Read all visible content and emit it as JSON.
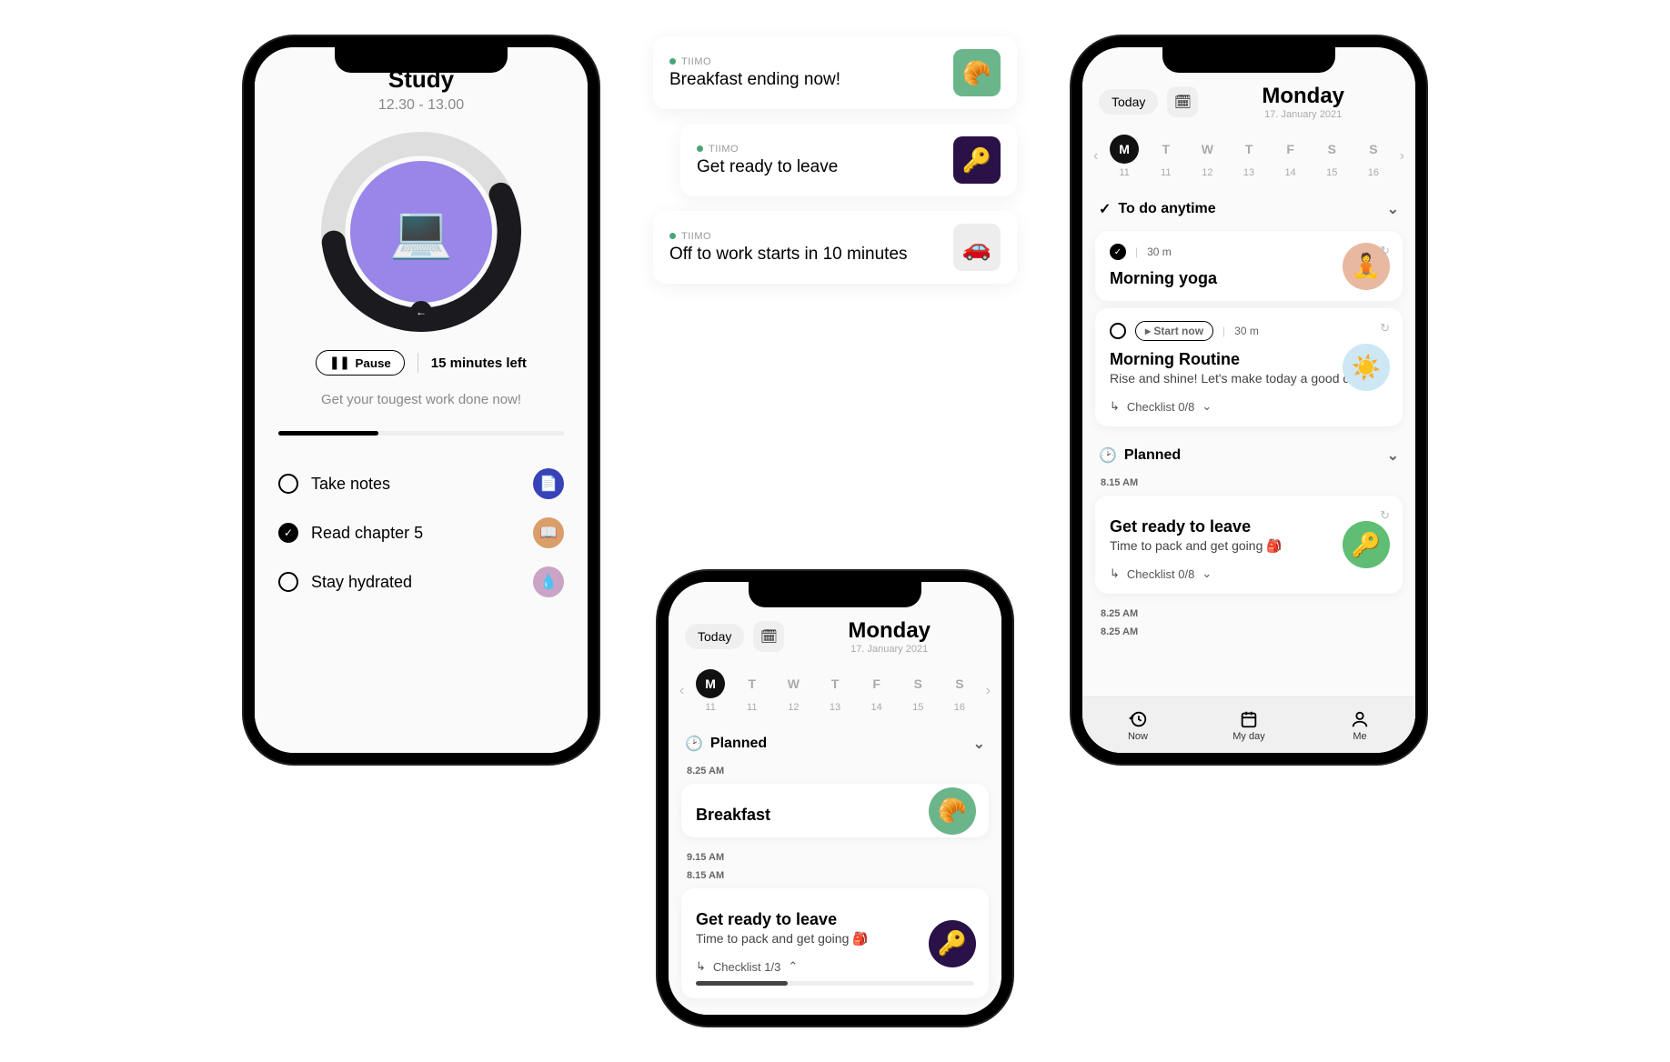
{
  "phone1": {
    "title": "Study",
    "timerange": "12.30 - 13.00",
    "progress_pct": 55,
    "pause_label": "Pause",
    "time_left": "15 minutes left",
    "motivation": "Get your tougest work done now!",
    "overall_progress_pct": 35,
    "checklist": [
      {
        "label": "Take notes",
        "done": false,
        "badge_emoji": "📄",
        "badge_color": "#3943B7"
      },
      {
        "label": "Read chapter 5",
        "done": true,
        "badge_emoji": "📖",
        "badge_color": "#D99E6A"
      },
      {
        "label": "Stay hydrated",
        "done": false,
        "badge_emoji": "💧",
        "badge_color": "#C9A4C7"
      }
    ],
    "activity_emoji": "💻",
    "ring_stroke": "#1b1b1f",
    "ring_track": "#dedede",
    "inner_color": "#9A85E8"
  },
  "notifications": [
    {
      "app": "TIIMO",
      "title": "Breakfast ending now!",
      "emoji": "🥐",
      "bg": "#6BB58B",
      "indent": false
    },
    {
      "app": "TIIMO",
      "title": "Get ready to leave",
      "emoji": "🔑",
      "bg": "#2A1147",
      "indent": true
    },
    {
      "app": "TIIMO",
      "title": "Off to work starts in 10 minutes",
      "emoji": "🚗",
      "bg": "#EDEDED",
      "indent": false
    }
  ],
  "phone2": {
    "today_label": "Today",
    "day_title": "Monday",
    "date_sub": "17. January 2021",
    "week": [
      {
        "d": "M",
        "n": "11",
        "active": true
      },
      {
        "d": "T",
        "n": "11"
      },
      {
        "d": "W",
        "n": "12"
      },
      {
        "d": "T",
        "n": "13"
      },
      {
        "d": "F",
        "n": "14"
      },
      {
        "d": "S",
        "n": "15"
      },
      {
        "d": "S",
        "n": "16"
      }
    ],
    "section_label": "Planned",
    "items": [
      {
        "time": "8.25 AM",
        "title": "Breakfast",
        "emoji": "🥐",
        "avatar_bg": "#6BB58B"
      },
      {
        "time": "9.15 AM"
      },
      {
        "time": "8.15 AM",
        "title": "Get ready to leave",
        "desc": "Time to pack and get going 🎒",
        "emoji": "🔑",
        "avatar_bg": "#2A1147",
        "checklist_label": "Checklist 1/3",
        "checklist_pct": 33
      }
    ]
  },
  "phone3": {
    "today_label": "Today",
    "day_title": "Monday",
    "date_sub": "17. January 2021",
    "week": [
      {
        "d": "M",
        "n": "11",
        "active": true
      },
      {
        "d": "T",
        "n": "11"
      },
      {
        "d": "W",
        "n": "12"
      },
      {
        "d": "T",
        "n": "13"
      },
      {
        "d": "F",
        "n": "14"
      },
      {
        "d": "S",
        "n": "15"
      },
      {
        "d": "S",
        "n": "16"
      }
    ],
    "anytime_label": "To do anytime",
    "anytime_items": [
      {
        "done": true,
        "duration": "30 m",
        "title": "Morning yoga",
        "emoji": "🧘",
        "avatar_bg": "#E8B9A0"
      },
      {
        "done": false,
        "start_now": "Start now",
        "duration": "30 m",
        "title": "Morning Routine",
        "desc": "Rise and shine! Let's make today a good day 💛",
        "emoji": "☀️",
        "avatar_bg": "#CDE7F4",
        "checklist_label": "Checklist 0/8"
      }
    ],
    "planned_label": "Planned",
    "planned_items": [
      {
        "time": "8.15 AM",
        "title": "Get ready to leave",
        "desc": "Time to pack and get going 🎒",
        "emoji": "🔑",
        "avatar_bg": "#5FBD74",
        "checklist_label": "Checklist 0/8"
      },
      {
        "time": "8.25 AM"
      },
      {
        "time": "8.25 AM"
      }
    ],
    "tabs": {
      "now": "Now",
      "myday": "My day",
      "me": "Me"
    }
  }
}
